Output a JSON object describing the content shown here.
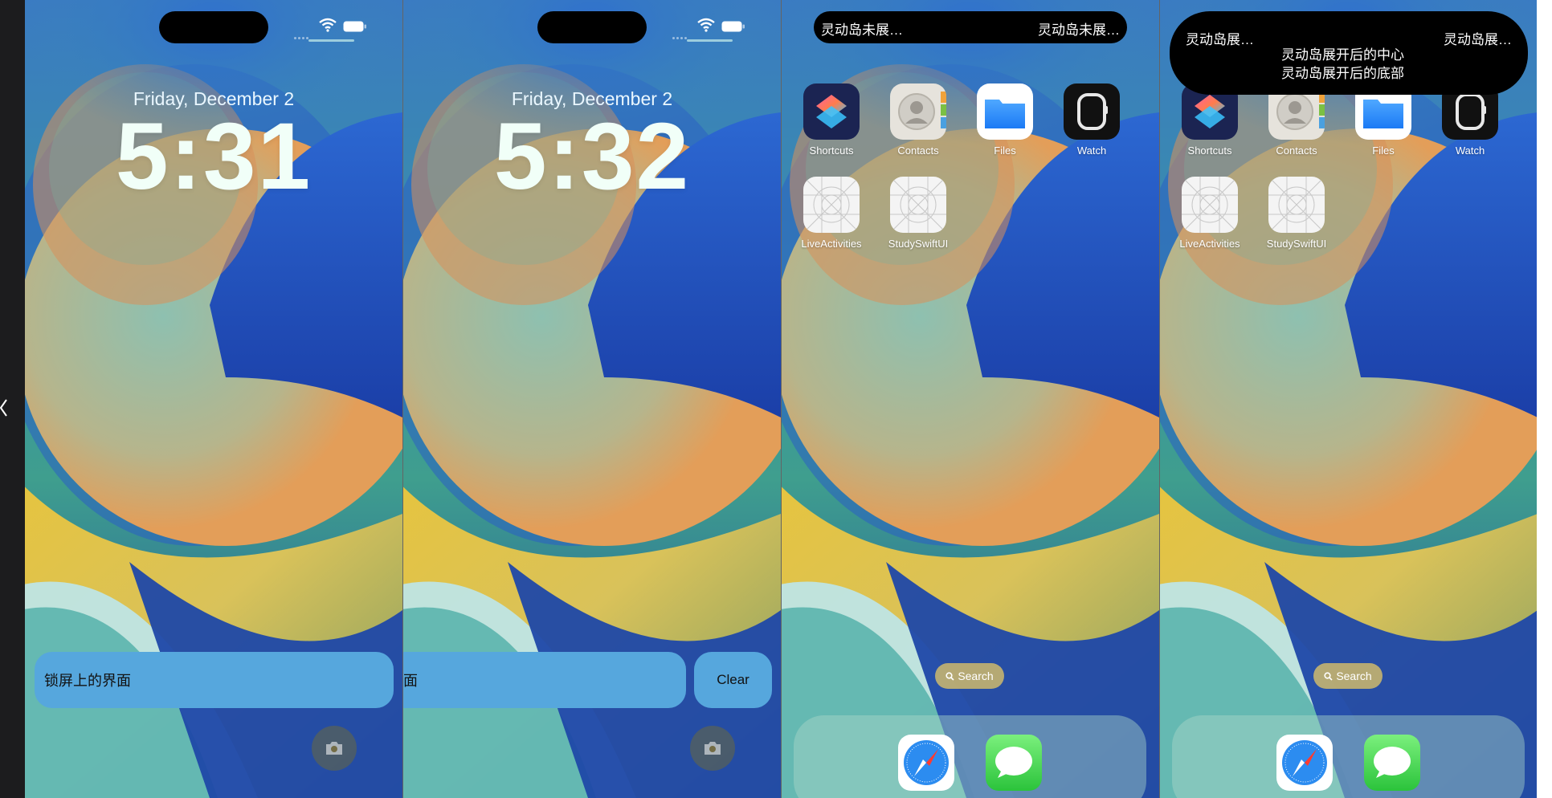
{
  "lock_screen_1": {
    "date": "Friday, December 2",
    "time": "5:31",
    "activity_text": "锁屏上的界面"
  },
  "lock_screen_2": {
    "date": "Friday, December 2",
    "time": "5:32",
    "activity_text": "面",
    "clear_label": "Clear"
  },
  "home_screen_compact": {
    "island_leading": "灵动岛未展…",
    "island_trailing": "灵动岛未展…"
  },
  "home_screen_expanded": {
    "island_leading": "灵动岛展…",
    "island_trailing": "灵动岛展…",
    "island_center": "灵动岛展开后的中心",
    "island_bottom": "灵动岛展开后的底部"
  },
  "apps": {
    "shortcuts": "Shortcuts",
    "contacts": "Contacts",
    "files": "Files",
    "watch": "Watch",
    "live_activities": "LiveActivities",
    "study_swiftui": "StudySwiftUI"
  },
  "search_label": "Search",
  "dock_apps": [
    "safari-icon",
    "messages-icon"
  ],
  "icons": [
    "chevron-left-icon",
    "wifi-icon",
    "battery-icon",
    "camera-icon",
    "search-icon"
  ],
  "colors": {
    "activity_background": "#56a7dd",
    "wallpaper_blue": "#2a63c6",
    "wallpaper_orange": "#e9a15a",
    "wallpaper_yellow": "#e6c83e"
  }
}
